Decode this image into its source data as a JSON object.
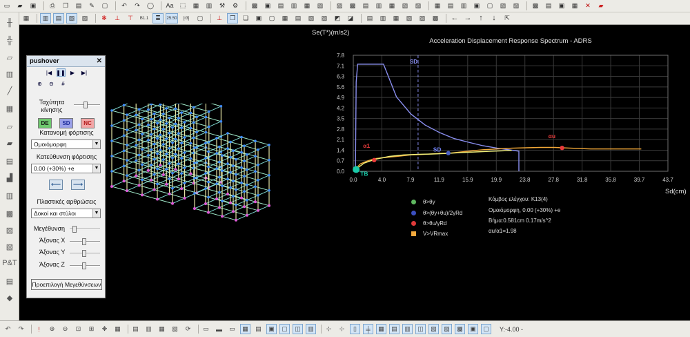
{
  "toolbar_top": {
    "icons": [
      "new-file-icon",
      "open-folder-icon",
      "save-icon",
      "print-icon",
      "copy-icon",
      "paste-icon",
      "pencil-icon",
      "frame-icon",
      "undo-icon",
      "redo-icon",
      "text-icon",
      "shape-icon",
      "select-icon",
      "window-icon",
      "grid-icon",
      "tools-icon",
      "settings-icon",
      "chart-icon",
      "lock-icon",
      "close-icon",
      "eraser-icon"
    ]
  },
  "toolbar_second": {
    "labels": {
      "b1": "B1.1",
      "b2": "25.50",
      "b3": "[r3]"
    },
    "icons": [
      "view-icon",
      "grid-icon",
      "rotate-icon",
      "select-icon",
      "hinge-icon",
      "joint-icon",
      "support-icon",
      "text-icon",
      "list-icon",
      "box-icon",
      "cube-icon",
      "box-3d-icon",
      "window-icon",
      "cross-section-icon",
      "table-icon",
      "arrow-left-icon",
      "arrow-right-icon",
      "arrow-up-icon",
      "arrow-down-icon",
      "export-icon"
    ]
  },
  "pushover": {
    "title": "pushover",
    "speed_label": "Ταχύτητα κίνησης",
    "buttons": {
      "de": "DE",
      "sd": "SD",
      "nc": "NC"
    },
    "load_distribution_label": "Κατανομή φόρτισης",
    "load_distribution_value": "Ομοιόμορφη",
    "load_direction_label": "Κατεύθυνση φόρτισης",
    "load_direction_value": "0.00 (+30%) +e",
    "plastic_hinges_label": "Πλαστικές αρθρώσεις",
    "plastic_hinges_value": "Δοκοί και στύλοι",
    "size_label": "Μεγέθυνση",
    "axis_x_label": "Άξονας X",
    "axis_y_label": "Άξονας Y",
    "axis_z_label": "Άξονας Z",
    "defaults_button": "Προεπιλογή Μεγεθύνσεων",
    "colors": {
      "de": "#6fc96f",
      "sd": "#9aa0e8",
      "nc": "#f2a6a6"
    }
  },
  "chart_data": {
    "type": "line",
    "title": "Acceleration Displacement Response Spectrum - ADRS",
    "ylabel": "Se(T*)(m/s2)",
    "xlabel": "Sd(cm)",
    "xlim": [
      0,
      43.7
    ],
    "ylim": [
      0,
      7.8
    ],
    "x_ticks": [
      "0.0",
      "4.0",
      "7.9",
      "11.9",
      "15.9",
      "19.9",
      "23.8",
      "27.8",
      "31.8",
      "35.8",
      "39.7",
      "43.7"
    ],
    "y_ticks": [
      "0.0",
      "0.7",
      "1.4",
      "2.1",
      "2.8",
      "3.5",
      "4.2",
      "4.9",
      "5.6",
      "6.3",
      "7.1",
      "7.8"
    ],
    "grid": true,
    "sd_line_x": 9.0,
    "sd_label": "SD.",
    "markers": {
      "tb": "TB",
      "sd": "SD",
      "a1": "α1",
      "au": "αu"
    },
    "series": [
      {
        "color": "#8a8ff0",
        "x": [
          0.3,
          0.4,
          0.6,
          1.2,
          3.0,
          4.2,
          6.0,
          8.0,
          10.0,
          12.0,
          14.0,
          16.0,
          18.0,
          20.0,
          22.0,
          23.0,
          23.0
        ],
        "y": [
          0.0,
          6.0,
          7.2,
          7.2,
          7.2,
          7.2,
          5.0,
          3.85,
          3.1,
          2.6,
          2.2,
          1.95,
          1.72,
          1.55,
          1.42,
          1.35,
          0.0
        ]
      },
      {
        "color": "#f2a838",
        "x": [
          0.0,
          1.0,
          2.0,
          3.0,
          4.0,
          5.0,
          6.0,
          7.0,
          8.0,
          9.0,
          10.0,
          12.0,
          13.5,
          15.0,
          18.0,
          20.0,
          22.0,
          24.0,
          26.0,
          28.0,
          30.0,
          33.0,
          36.0,
          39.0,
          40.0
        ],
        "y": [
          0.0,
          0.5,
          0.7,
          0.85,
          0.9,
          0.95,
          1.0,
          1.05,
          1.1,
          1.12,
          1.14,
          1.2,
          1.22,
          1.3,
          1.45,
          1.5,
          1.55,
          1.58,
          1.6,
          1.6,
          1.56,
          1.5,
          1.5,
          1.5,
          1.5
        ]
      },
      {
        "color": "#f0f07a",
        "x": [
          0.0,
          1.5,
          3.0,
          5.0,
          7.0,
          9.0,
          11.0,
          13.0,
          15.0,
          17.0,
          19.0,
          21.0,
          22.0
        ],
        "y": [
          0.0,
          0.55,
          0.8,
          1.0,
          1.1,
          1.14,
          1.16,
          1.2,
          1.26,
          1.3,
          1.34,
          1.38,
          1.4
        ]
      }
    ],
    "points": [
      {
        "label": "TB",
        "x": 0.4,
        "y": 0.12,
        "color": "#19c9a8"
      },
      {
        "label": "α1",
        "x": 2.9,
        "y": 0.75,
        "color": "#e83b3b"
      },
      {
        "label": "SD",
        "x": 13.2,
        "y": 1.22,
        "color": "#4a5fc4"
      },
      {
        "label": "αu",
        "x": 29.0,
        "y": 1.57,
        "color": "#e83b3b"
      }
    ]
  },
  "legend": {
    "items": [
      {
        "label": "θ>θy",
        "color": "#5fb860",
        "shape": "dot"
      },
      {
        "label": "θ>(θy+θu)/2γRd",
        "color": "#3b4fc0",
        "shape": "dot"
      },
      {
        "label": "θ>θu/γRd",
        "color": "#e03a3a",
        "shape": "dot"
      },
      {
        "label": "V>VRmax",
        "color": "#f2a83c",
        "shape": "square"
      }
    ],
    "info": [
      "Κόμβος ελέγχου: K13(4)",
      "Ομοιόμορφη, 0.00 (+30%) +e",
      "Βήμα:0.581cm 0.17m/s^2",
      "αu/α1=1.98"
    ]
  },
  "statusbar": {
    "icons": [
      "undo-icon",
      "redo-icon",
      "zoom-in-icon",
      "zoom-out-icon",
      "zoom-window-icon",
      "zoom-all-icon",
      "pan-icon",
      "grid-icon",
      "snap-icon",
      "ortho-icon",
      "layers-icon",
      "table-icon",
      "refresh-icon",
      "cursor-icon",
      "move-icon"
    ],
    "text": "Υ:-4.00 -"
  }
}
